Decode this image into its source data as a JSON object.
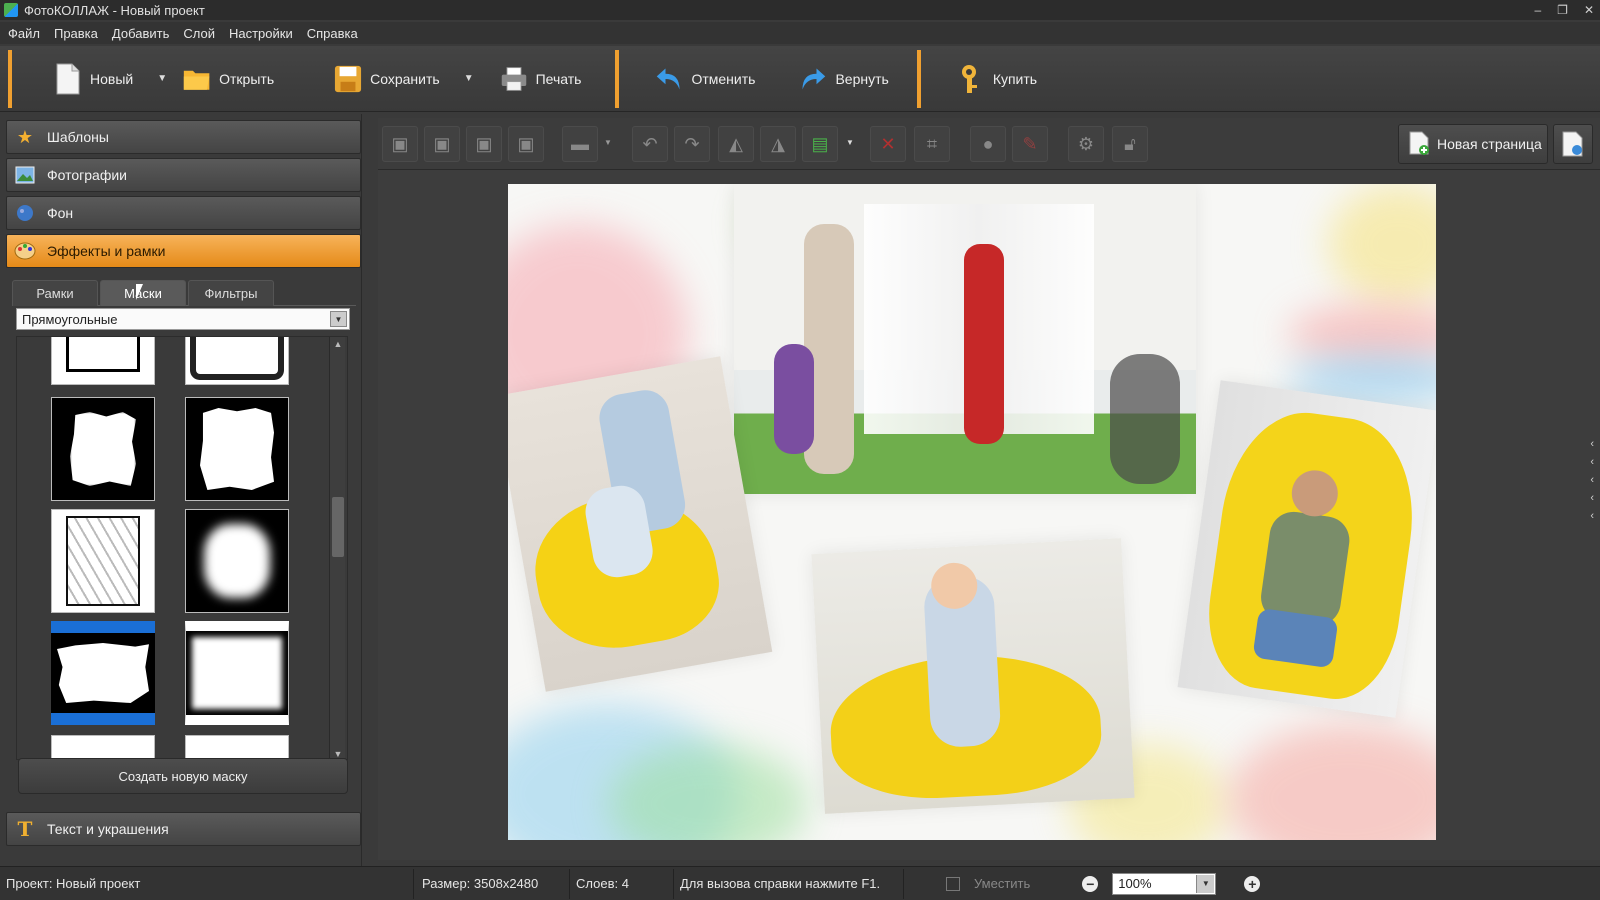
{
  "window": {
    "title": "ФотоКОЛЛАЖ - Новый проект",
    "controls": [
      "‒",
      "❐",
      "✕"
    ]
  },
  "menu": [
    "Файл",
    "Правка",
    "Добавить",
    "Слой",
    "Настройки",
    "Справка"
  ],
  "toolbar": {
    "new": "Новый",
    "open": "Открыть",
    "save": "Сохранить",
    "print": "Печать",
    "undo": "Отменить",
    "redo": "Вернуть",
    "buy": "Купить"
  },
  "sidebar": {
    "sections": [
      "Шаблоны",
      "Фотографии",
      "Фон",
      "Эффекты и рамки"
    ],
    "bottom_section": "Текст и украшения",
    "tabs": [
      "Рамки",
      "Маски",
      "Фильтры"
    ],
    "active_tab": "Маски",
    "mask_category": "Прямоугольные",
    "create_mask_button": "Создать новую маску"
  },
  "editor": {
    "new_page_button": "Новая страница"
  },
  "status": {
    "project": "Проект:  Новый проект",
    "size": "Размер:  3508x2480",
    "layers": "Слоев:  4",
    "help": "Для вызова справки нажмите F1.",
    "fit": "Уместить",
    "zoom": "100%"
  },
  "colors": {
    "accent": "#f0a030",
    "active_section": "#f0a040"
  }
}
